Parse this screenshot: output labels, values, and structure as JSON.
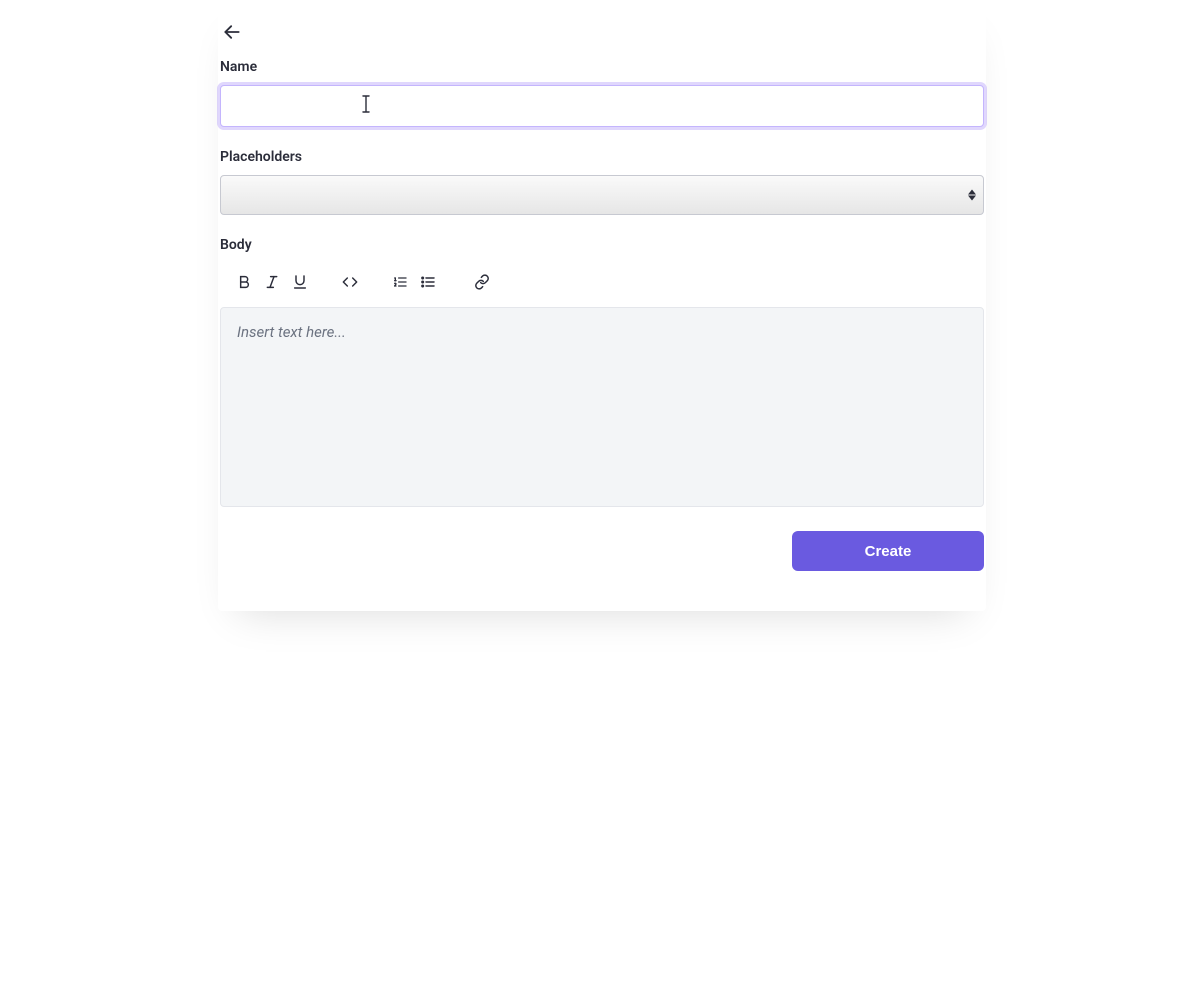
{
  "form": {
    "name_label": "Name",
    "name_value": "",
    "placeholders_label": "Placeholders",
    "placeholders_value": "",
    "body_label": "Body",
    "body_placeholder": "Insert text here..."
  },
  "actions": {
    "create_label": "Create"
  }
}
